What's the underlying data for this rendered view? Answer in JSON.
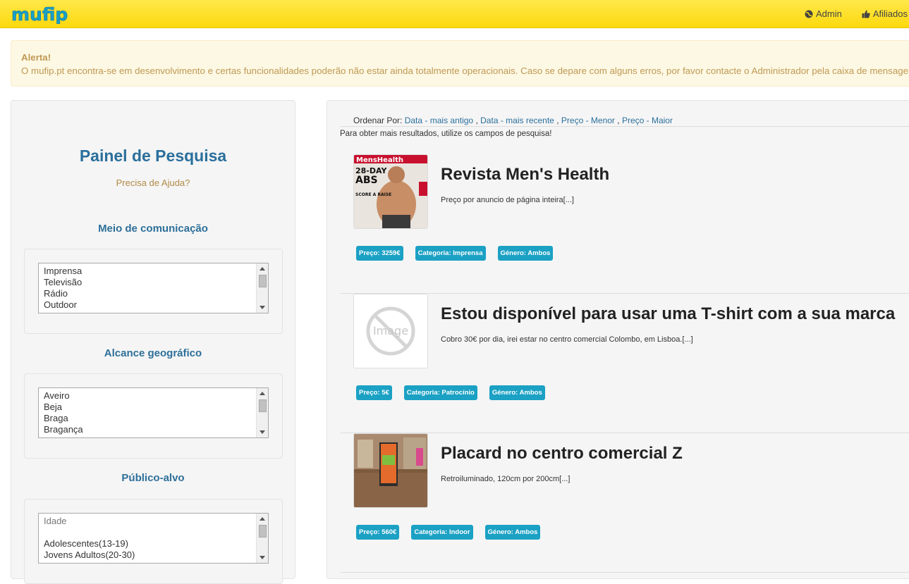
{
  "app": {
    "logo_text": "mufip"
  },
  "nav": {
    "admin": "Admin",
    "affiliates": "Afiliados"
  },
  "alert": {
    "title": "Alerta!",
    "message": "O mufip.pt encontra-se em desenvolvimento e certas funcionalidades poderão não estar ainda totalmente operacionais. Caso se depare com alguns erros, por favor contacte o Administrador pela caixa de mensagens."
  },
  "search": {
    "title": "Painel de Pesquisa",
    "help": "Precisa de Ajuda?",
    "media": {
      "label": "Meio de comunicação",
      "options": [
        "Imprensa",
        "Televisão",
        "Rádio",
        "Outdoor"
      ]
    },
    "geo": {
      "label": "Alcance geográfico",
      "options": [
        "Aveiro",
        "Beja",
        "Braga",
        "Bragança"
      ]
    },
    "audience": {
      "label": "Público-alvo",
      "options": [
        "Idade",
        "",
        "Adolescentes(13-19)",
        "Jovens Adultos(20-30)"
      ]
    }
  },
  "results": {
    "order_by": "Ordenar Por:",
    "order_options": [
      "Data - mais antigo",
      "Data - mais recente",
      "Preço - Menor",
      "Preço - Maior"
    ],
    "hint": "Para obter mais resultados, utilize os campos de pesquisa!",
    "items": [
      {
        "title": "Revista Men's Health",
        "description": "Preço por anuncio de página inteira[...]",
        "price": "Preço: 3259€",
        "category": "Categoria: Imprensa",
        "gender": "Género: Ambos",
        "thumb_text": [
          "MensHealth",
          "28-DAY",
          "ABS",
          "SCORE A RAISE"
        ]
      },
      {
        "title": "Estou disponível para usar uma T-shirt com a sua marca",
        "description": "Cobro 30€ por dia, irei estar no centro comercial Colombo, em Lisboa.[...]",
        "price": "Preço: 5€",
        "category": "Categoria: Patrocínio",
        "gender": "Género: Ambos",
        "thumb_text": [
          "Image"
        ]
      },
      {
        "title": "Placard no centro comercial Z",
        "description": "Retroiluminado, 120cm por 200cm[...]",
        "price": "Preço: 560€",
        "category": "Categoria: Indoor",
        "gender": "Género: Ambos",
        "thumb_text": []
      }
    ]
  },
  "colors": {
    "topbar": "#fcd90f",
    "link": "#2a6f9c",
    "badge": "#1ba1c4",
    "alert_text": "#c09853"
  }
}
